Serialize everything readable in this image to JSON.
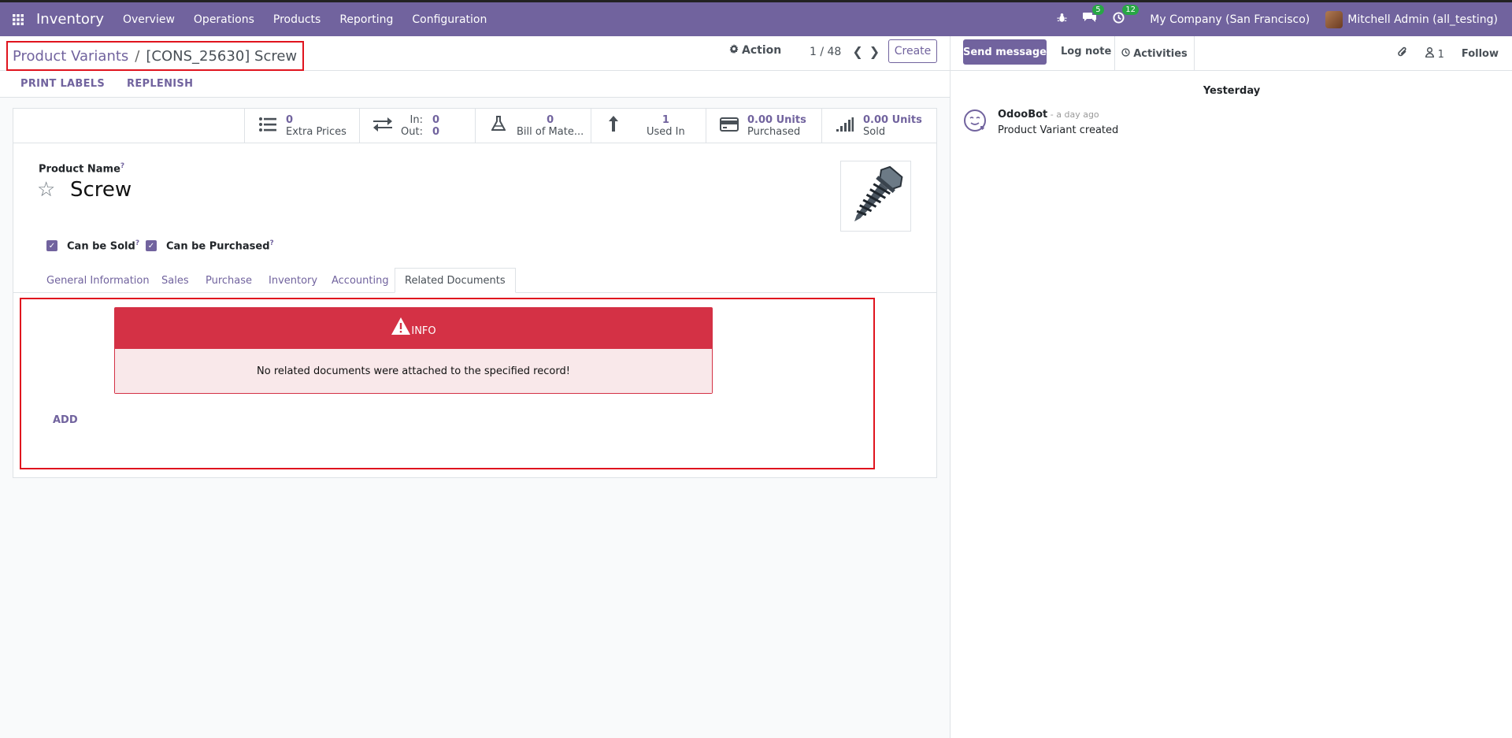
{
  "navbar": {
    "app_name": "Inventory",
    "menu": [
      "Overview",
      "Operations",
      "Products",
      "Reporting",
      "Configuration"
    ],
    "messages_count": "5",
    "activities_count": "12",
    "company": "My Company (San Francisco)",
    "user": "Mitchell Admin (all_testing)"
  },
  "control": {
    "breadcrumb_parent": "Product Variants",
    "breadcrumb_sep": "/",
    "breadcrumb_current": "[CONS_25630] Screw",
    "action_label": "Action",
    "pager": "1 / 48",
    "create_label": "Create"
  },
  "statusbar": {
    "print_labels": "PRINT LABELS",
    "replenish": "REPLENISH"
  },
  "smart_buttons": {
    "extra_prices_val": "0",
    "extra_prices_lbl": "Extra Prices",
    "in_lbl": "In:",
    "in_val": "0",
    "out_lbl": "Out:",
    "out_val": "0",
    "bom_val": "0",
    "bom_lbl": "Bill of Mate...",
    "used_in_val": "1",
    "used_in_lbl": "Used In",
    "purchased_val": "0.00 Units",
    "purchased_lbl": "Purchased",
    "sold_val": "0.00 Units",
    "sold_lbl": "Sold"
  },
  "form": {
    "product_name_label": "Product Name",
    "help_mark": "?",
    "product_name": "Screw",
    "can_be_sold": "Can be Sold",
    "can_be_purchased": "Can be Purchased",
    "tabs": [
      "General Information",
      "Sales",
      "Purchase",
      "Inventory",
      "Accounting",
      "Related Documents"
    ],
    "active_tab": "Related Documents"
  },
  "related_docs": {
    "alert_title": "INFO",
    "alert_message": "No related documents were attached to the specified record!",
    "add_label": "ADD"
  },
  "chatter": {
    "send_message": "Send message",
    "log_note": "Log note",
    "activities": "Activities",
    "followers_count": "1",
    "follow": "Follow",
    "day": "Yesterday",
    "message": {
      "author": "OdooBot",
      "time": " - a day ago",
      "body": "Product Variant created"
    }
  },
  "colors": {
    "brand": "#71639e",
    "danger": "#d43145",
    "highlight": "#e0141e",
    "badge": "#28a745"
  }
}
